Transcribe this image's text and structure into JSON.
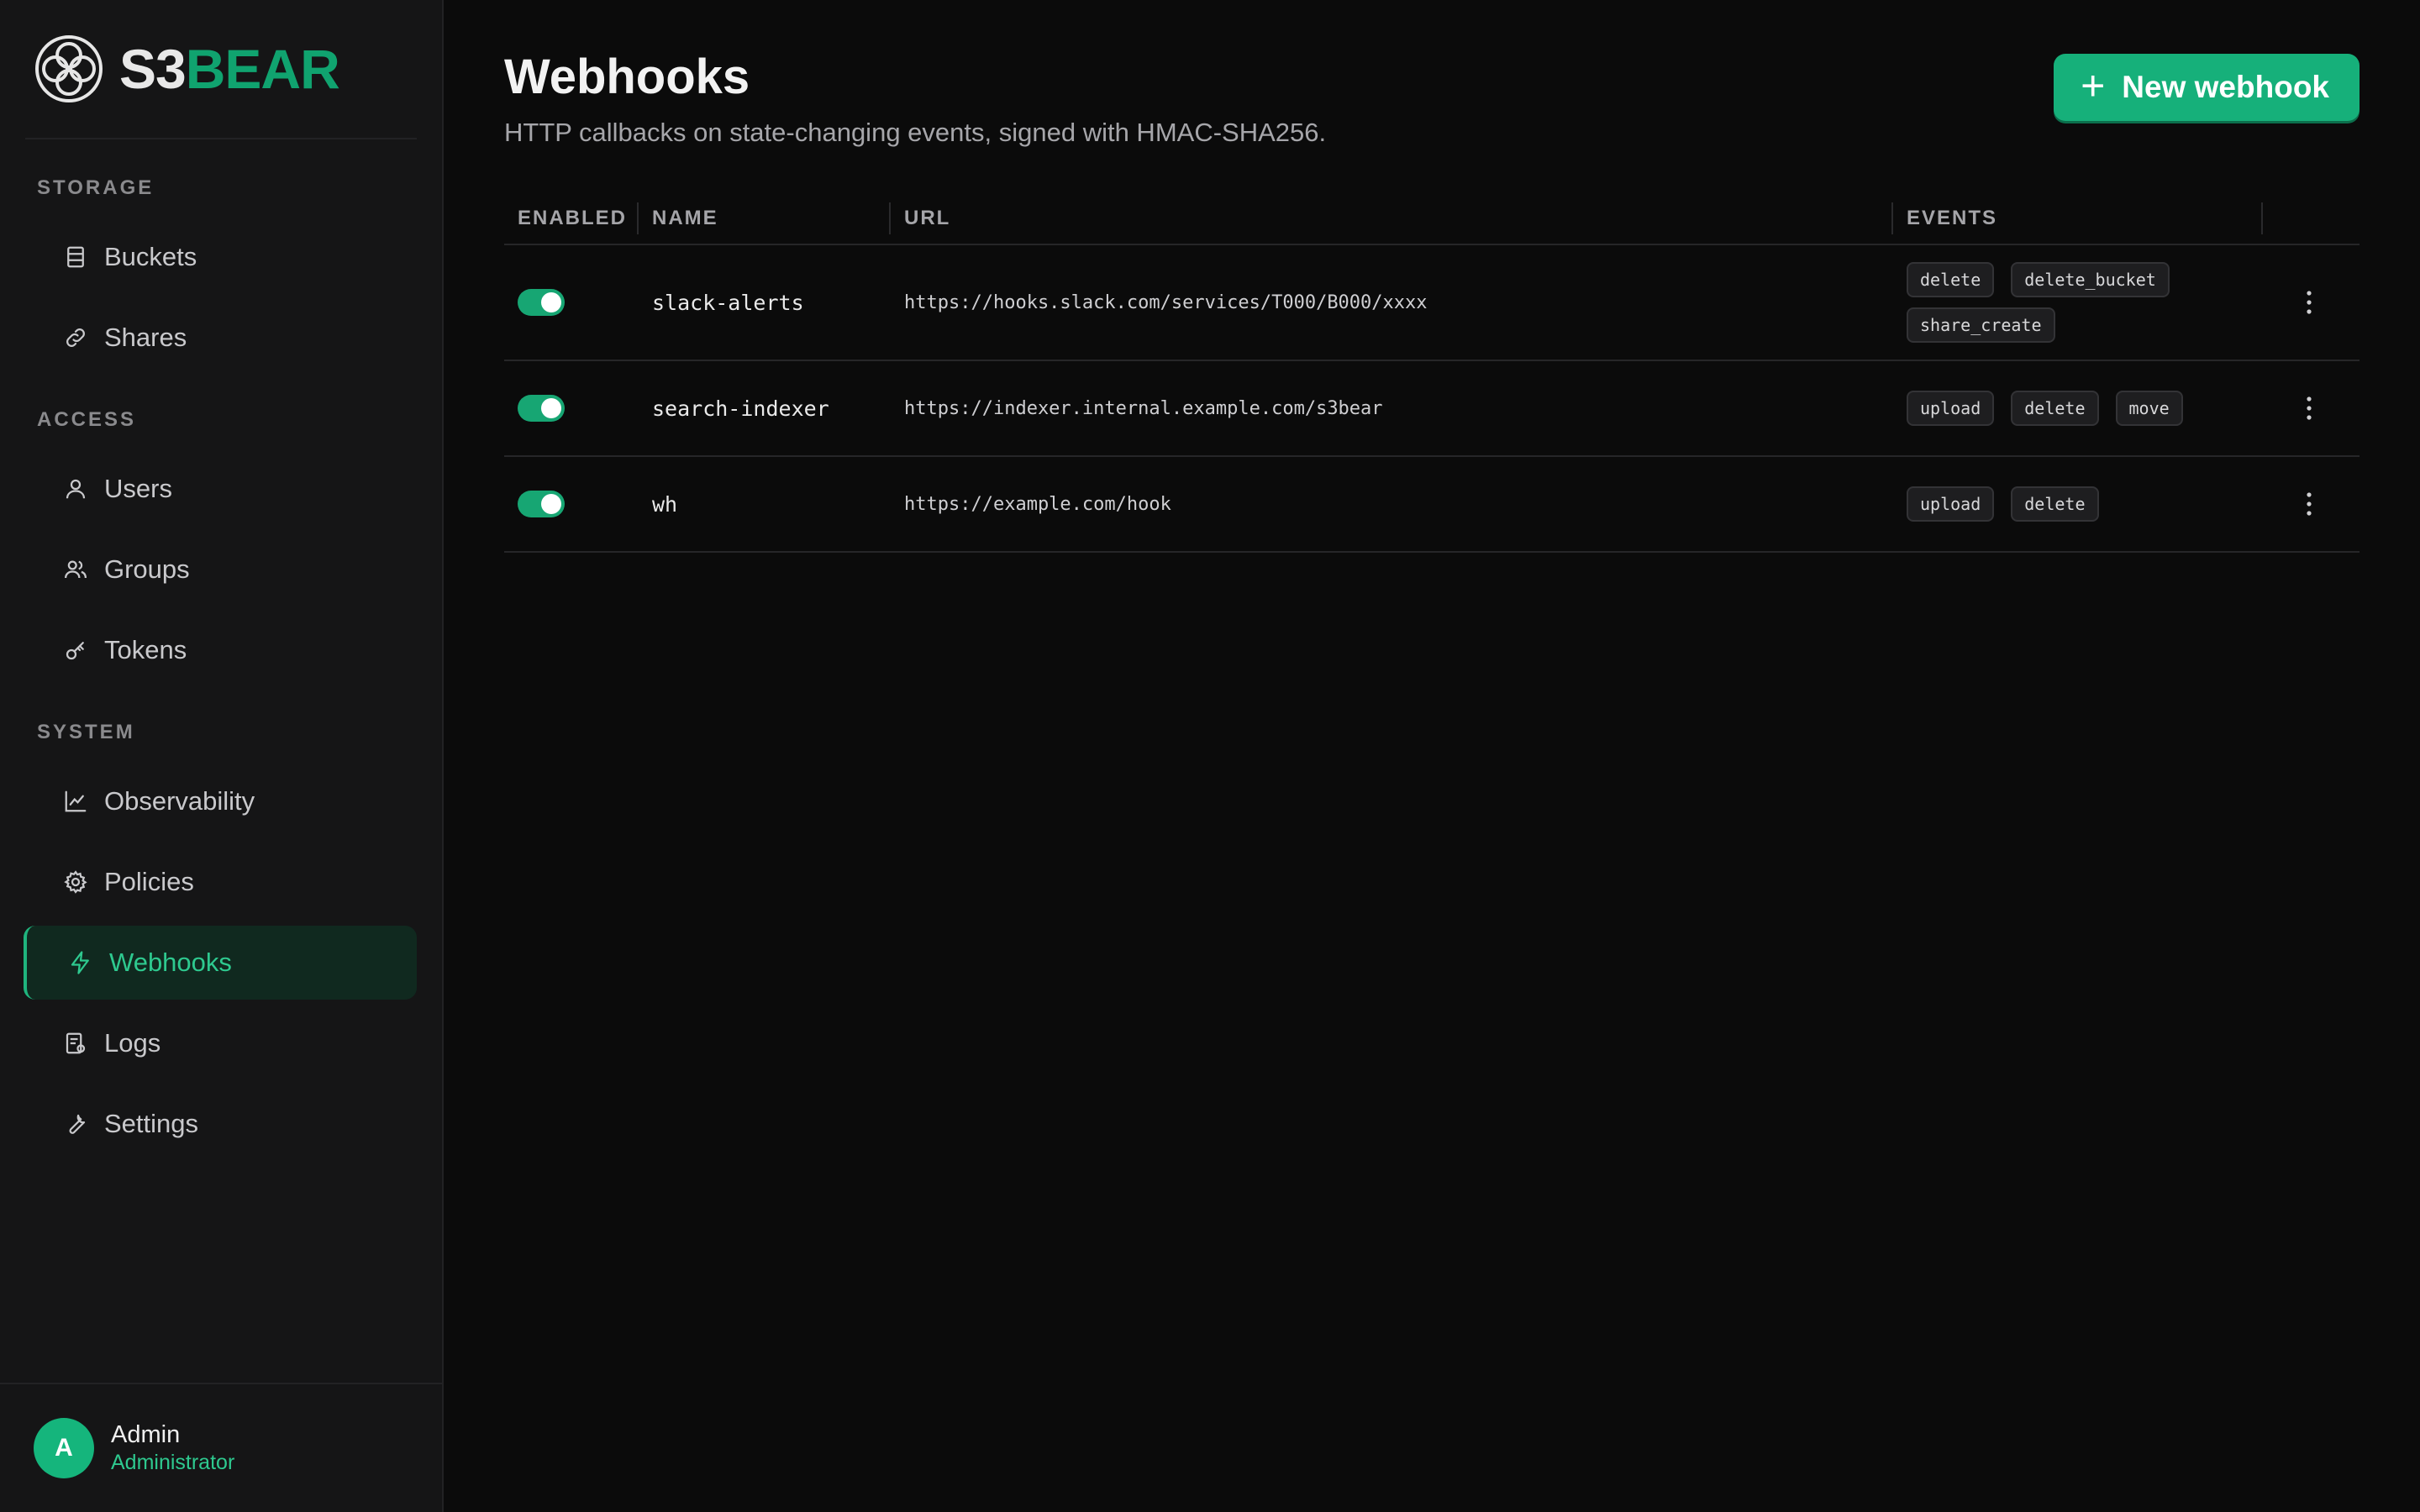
{
  "brand": {
    "prefix": "S3",
    "suffix": "BEAR",
    "logo_icon": "celtic-knot-logo"
  },
  "sidebar": {
    "sections": [
      {
        "heading": "STORAGE",
        "items": [
          {
            "label": "Buckets",
            "icon": "server-stack-icon"
          },
          {
            "label": "Shares",
            "icon": "link-icon"
          }
        ]
      },
      {
        "heading": "ACCESS",
        "items": [
          {
            "label": "Users",
            "icon": "user-icon"
          },
          {
            "label": "Groups",
            "icon": "users-icon"
          },
          {
            "label": "Tokens",
            "icon": "key-icon"
          }
        ]
      },
      {
        "heading": "SYSTEM",
        "items": [
          {
            "label": "Observability",
            "icon": "line-chart-icon"
          },
          {
            "label": "Policies",
            "icon": "gear-icon"
          },
          {
            "label": "Webhooks",
            "icon": "lightning-icon",
            "active": true
          },
          {
            "label": "Logs",
            "icon": "log-file-icon"
          },
          {
            "label": "Settings",
            "icon": "wrench-icon"
          }
        ]
      }
    ],
    "user": {
      "initial": "A",
      "name": "Admin",
      "role": "Administrator"
    }
  },
  "page": {
    "title": "Webhooks",
    "subtitle": "HTTP callbacks on state-changing events, signed with HMAC-SHA256.",
    "new_button": "New webhook"
  },
  "table": {
    "columns": [
      "ENABLED",
      "NAME",
      "URL",
      "EVENTS"
    ],
    "rows": [
      {
        "enabled": true,
        "name": "slack-alerts",
        "url": "https://hooks.slack.com/services/T000/B000/xxxx",
        "events": [
          "delete",
          "delete_bucket",
          "share_create"
        ]
      },
      {
        "enabled": true,
        "name": "search-indexer",
        "url": "https://indexer.internal.example.com/s3bear",
        "events": [
          "upload",
          "delete",
          "move"
        ]
      },
      {
        "enabled": true,
        "name": "wh",
        "url": "https://example.com/hook",
        "events": [
          "upload",
          "delete"
        ]
      }
    ]
  },
  "colors": {
    "accent": "#16b07a",
    "accent_text": "#2ec98f",
    "background": "#0b0b0b",
    "sidebar": "#151516"
  }
}
